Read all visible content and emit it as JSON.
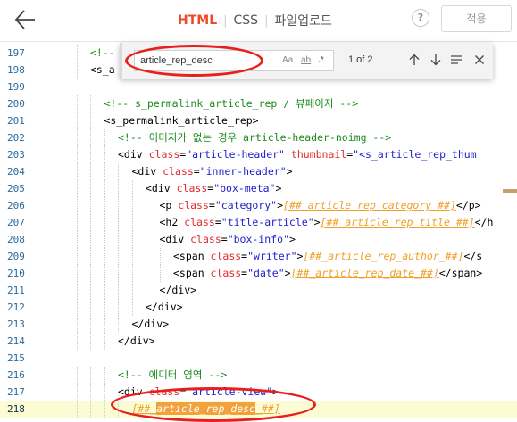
{
  "toolbar": {
    "tabs": [
      {
        "label": "HTML",
        "active": true
      },
      {
        "label": "CSS",
        "active": false
      },
      {
        "label": "파일업로드",
        "active": false
      }
    ],
    "help_label": "?",
    "apply_label": "적용"
  },
  "find": {
    "query": "article_rep_desc",
    "options": {
      "case": "Aa",
      "word": "ab",
      "regex": ".*"
    },
    "match_count": "1 of 2"
  },
  "colors": {
    "accent": "#ee4b2b",
    "annotation": "#e8201c",
    "line_number": "#2a6b9c",
    "comment": "#1b8b1b",
    "attribute": "#e42b2b",
    "attribute_value": "#2020cf",
    "template_var": "#f0a028",
    "current_line_bg": "#fbfbd4"
  },
  "editor": {
    "lines": [
      {
        "num": "197",
        "indent": 2,
        "tokens": [
          {
            "t": "cmt",
            "v": "<!-- "
          }
        ]
      },
      {
        "num": "198",
        "indent": 2,
        "tokens": [
          {
            "t": "tag",
            "v": "<s_a"
          }
        ]
      },
      {
        "num": "199",
        "indent": 0,
        "tokens": []
      },
      {
        "num": "200",
        "indent": 3,
        "tokens": [
          {
            "t": "cmt",
            "v": "<!-- s_permalink_article_rep / 뷰페이지 -->"
          }
        ]
      },
      {
        "num": "201",
        "indent": 3,
        "tokens": [
          {
            "t": "tag",
            "v": "<s_permalink_article_rep>"
          }
        ]
      },
      {
        "num": "202",
        "indent": 4,
        "tokens": [
          {
            "t": "cmt",
            "v": "<!-- 이미지가 없는 경우 article-header-noimg -->"
          }
        ]
      },
      {
        "num": "203",
        "indent": 4,
        "tokens": [
          {
            "t": "tag",
            "v": "<div "
          },
          {
            "t": "attr",
            "v": "class"
          },
          {
            "t": "tag",
            "v": "="
          },
          {
            "t": "val",
            "v": "\"article-header\""
          },
          {
            "t": "tag",
            "v": " "
          },
          {
            "t": "attr",
            "v": "thumbnail"
          },
          {
            "t": "tag",
            "v": "="
          },
          {
            "t": "val",
            "v": "\"<s_article_rep_thum"
          }
        ]
      },
      {
        "num": "204",
        "indent": 5,
        "tokens": [
          {
            "t": "tag",
            "v": "<div "
          },
          {
            "t": "attr",
            "v": "class"
          },
          {
            "t": "tag",
            "v": "="
          },
          {
            "t": "val",
            "v": "\"inner-header\""
          },
          {
            "t": "tag",
            "v": ">"
          }
        ]
      },
      {
        "num": "205",
        "indent": 6,
        "tokens": [
          {
            "t": "tag",
            "v": "<div "
          },
          {
            "t": "attr",
            "v": "class"
          },
          {
            "t": "tag",
            "v": "="
          },
          {
            "t": "val",
            "v": "\"box-meta\""
          },
          {
            "t": "tag",
            "v": ">"
          }
        ]
      },
      {
        "num": "206",
        "indent": 7,
        "tokens": [
          {
            "t": "tag",
            "v": "<p "
          },
          {
            "t": "attr",
            "v": "class"
          },
          {
            "t": "tag",
            "v": "="
          },
          {
            "t": "val",
            "v": "\"category\""
          },
          {
            "t": "tag",
            "v": ">"
          },
          {
            "t": "var",
            "v": "[##_article_rep_category_##]"
          },
          {
            "t": "tag",
            "v": "</p>"
          }
        ]
      },
      {
        "num": "207",
        "indent": 7,
        "tokens": [
          {
            "t": "tag",
            "v": "<h2 "
          },
          {
            "t": "attr",
            "v": "class"
          },
          {
            "t": "tag",
            "v": "="
          },
          {
            "t": "val",
            "v": "\"title-article\""
          },
          {
            "t": "tag",
            "v": ">"
          },
          {
            "t": "var",
            "v": "[##_article_rep_title_##]"
          },
          {
            "t": "tag",
            "v": "</h"
          }
        ]
      },
      {
        "num": "208",
        "indent": 7,
        "tokens": [
          {
            "t": "tag",
            "v": "<div "
          },
          {
            "t": "attr",
            "v": "class"
          },
          {
            "t": "tag",
            "v": "="
          },
          {
            "t": "val",
            "v": "\"box-info\""
          },
          {
            "t": "tag",
            "v": ">"
          }
        ]
      },
      {
        "num": "209",
        "indent": 8,
        "tokens": [
          {
            "t": "tag",
            "v": "<span "
          },
          {
            "t": "attr",
            "v": "class"
          },
          {
            "t": "tag",
            "v": "="
          },
          {
            "t": "val",
            "v": "\"writer\""
          },
          {
            "t": "tag",
            "v": ">"
          },
          {
            "t": "var",
            "v": "[##_article_rep_author_##]"
          },
          {
            "t": "tag",
            "v": "</s"
          }
        ]
      },
      {
        "num": "210",
        "indent": 8,
        "tokens": [
          {
            "t": "tag",
            "v": "<span "
          },
          {
            "t": "attr",
            "v": "class"
          },
          {
            "t": "tag",
            "v": "="
          },
          {
            "t": "val",
            "v": "\"date\""
          },
          {
            "t": "tag",
            "v": ">"
          },
          {
            "t": "var",
            "v": "[##_article_rep_date_##]"
          },
          {
            "t": "tag",
            "v": "</span>"
          }
        ]
      },
      {
        "num": "211",
        "indent": 7,
        "tokens": [
          {
            "t": "tag",
            "v": "</div>"
          }
        ]
      },
      {
        "num": "212",
        "indent": 6,
        "tokens": [
          {
            "t": "tag",
            "v": "</div>"
          }
        ]
      },
      {
        "num": "213",
        "indent": 5,
        "tokens": [
          {
            "t": "tag",
            "v": "</div>"
          }
        ]
      },
      {
        "num": "214",
        "indent": 4,
        "tokens": [
          {
            "t": "tag",
            "v": "</div>"
          }
        ]
      },
      {
        "num": "215",
        "indent": 0,
        "tokens": []
      },
      {
        "num": "216",
        "indent": 4,
        "tokens": [
          {
            "t": "cmt",
            "v": "<!-- 에디터 영역 -->"
          }
        ]
      },
      {
        "num": "217",
        "indent": 4,
        "tokens": [
          {
            "t": "tag",
            "v": "<div "
          },
          {
            "t": "attr",
            "v": "class"
          },
          {
            "t": "tag",
            "v": "="
          },
          {
            "t": "val",
            "v": "\"article-view\""
          },
          {
            "t": "tag",
            "v": ">"
          }
        ]
      },
      {
        "num": "218",
        "indent": 5,
        "current": true,
        "tokens": [
          {
            "t": "var",
            "v": "[##_"
          },
          {
            "t": "hl",
            "v": "article_rep_desc"
          },
          {
            "t": "var",
            "v": "_##]"
          }
        ]
      }
    ]
  }
}
